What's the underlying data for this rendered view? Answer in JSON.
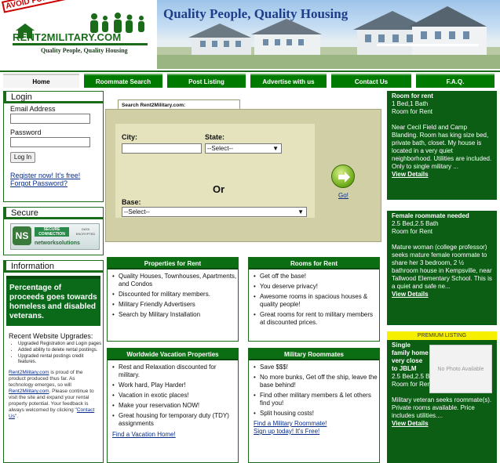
{
  "header": {
    "badge": "AVOID FORECLOSURE!",
    "logo_text": "RENT2MILITARY.COM",
    "tagline": "Quality People, Quality Housing",
    "banner_title": "Quality People, Quality Housing"
  },
  "nav": {
    "tabs": [
      "Home",
      "Roommate Search",
      "Post Listing",
      "Advertise with us",
      "Contact Us",
      "F.A.Q."
    ]
  },
  "login": {
    "title": "Login",
    "email_label": "Email Address",
    "password_label": "Password",
    "button": "Log In",
    "register_link": "Register now! It's free!",
    "forgot_link": "Forgot Password?"
  },
  "secure": {
    "title": "Secure",
    "mark": "NS",
    "secure_text": "SECURE CONNECTION",
    "data_text": "DATA ENCRYPTED",
    "brand": "networksolutions"
  },
  "information": {
    "title": "Information",
    "banner": "Percentage of proceeds goes towards homeless and disabled veterans.",
    "upgrades_title": "Recent Website Upgrades:",
    "upgrades": [
      "Upgraded Registration and Login pages",
      "Added ability to delete rental postings.",
      "Upgraded rental postings credit features."
    ],
    "para_1": "Rent2Military.com",
    "para_2": " is proud of the product produced thus far. As technology emerges, so will ",
    "para_3": "Rent2Military.com",
    "para_4": ". Please continue to visit the site and expand your rental property potential. Your feedback is always welcomed by clicking \"",
    "para_link": "Contact Us",
    "para_5": "\"."
  },
  "search": {
    "tab_label": "Search Rent2Military.com:",
    "city_label": "City:",
    "state_label": "State:",
    "state_value": "--Select--",
    "or_label": "Or",
    "base_label": "Base:",
    "base_value": "--Select--",
    "go_label": "Go!"
  },
  "properties": {
    "title": "Properties for Rent",
    "items": [
      "Quality Houses, Townhouses, Apartments, and Condos",
      "Discounted for military members.",
      "Military Friendly Advertisers",
      "Search by Military Installation"
    ]
  },
  "rooms": {
    "title": "Rooms for Rent",
    "items": [
      "Get off the base!",
      "You deserve privacy!",
      "Awesome rooms in spacious houses & quality people!",
      "Great rooms for rent to military members at discounted prices."
    ]
  },
  "vacation": {
    "title": "Worldwide Vacation Properties",
    "items": [
      "Rest and Relaxation discounted for military.",
      "Work hard, Play Harder!",
      "Vacation in exotic places!",
      "Make your reservation NOW!",
      "Great housing for temporary duty (TDY) assignments"
    ],
    "link": "Find a Vacation Home!"
  },
  "roommates": {
    "title": "Military Roommates",
    "items": [
      "Save $$$!",
      "No more bunks, Get off the ship, leave the base behind!",
      "Find other military members & let others find you!",
      "Split housing costs!"
    ],
    "link1": "Find a Military Roommate!",
    "link2": "Sign up today! It's Free!"
  },
  "listings": [
    {
      "title": "Room for rent",
      "beds": "1 Bed,1 Bath",
      "type": "Room for Rent",
      "desc": "Near Cecil Field and Camp Blanding. Room has king size bed, private bath, closet. My house is located in a very quiet neighborhood. Utilities are included. Only to single military ...",
      "link": "View Details"
    },
    {
      "title": "Female roommate needed",
      "beds": "2.5 Bed,2.5 Bath",
      "type": "Room for Rent",
      "desc": "Mature woman (college professor) seeks mature female roommate to share her 3 bedroom, 2 ½ bathroom house in Kempsville, near Tallwood Elementary School. This is a quiet and safe ne...",
      "link": "View Details"
    }
  ],
  "premium": {
    "header": "PREMIUM LISTING",
    "title": "Single family home very close to JBLM",
    "beds": "2.5 Bed,2.5 Bath",
    "type": "Room for Rent",
    "photo": "No Photo Available",
    "desc": "Military veteran seeks roommate(s). Private rooms available. Price includes utilities....",
    "link": "View Details"
  },
  "colors": {
    "brand_green": "#0b6e12",
    "dark_green": "#0b5e14",
    "link_blue": "#0a2e8a",
    "search_bg": "#d0cfa6",
    "premium_yellow": "#f6f000"
  }
}
